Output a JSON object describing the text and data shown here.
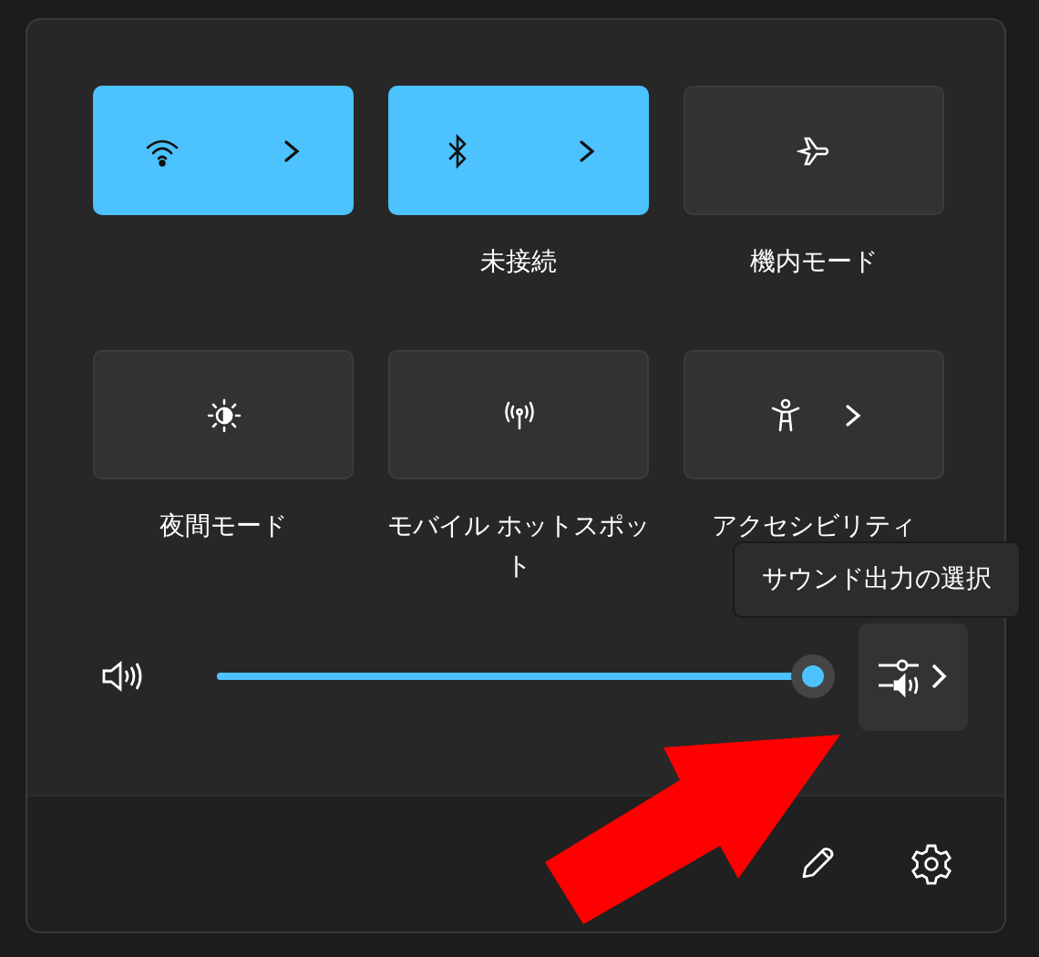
{
  "tiles": [
    {
      "on": true,
      "expandable": true
    },
    {
      "on": true,
      "expandable": true,
      "label": "未接続"
    },
    {
      "on": false,
      "expandable": false,
      "label": "機内モード"
    },
    {
      "on": false,
      "expandable": false,
      "label": "夜間モード"
    },
    {
      "on": false,
      "expandable": false,
      "label": "モバイル ホットスポット"
    },
    {
      "on": false,
      "expandable": true,
      "label": "アクセシビリティ"
    }
  ],
  "volume": {
    "level": 0.98
  },
  "tooltip": "サウンド出力の選択"
}
